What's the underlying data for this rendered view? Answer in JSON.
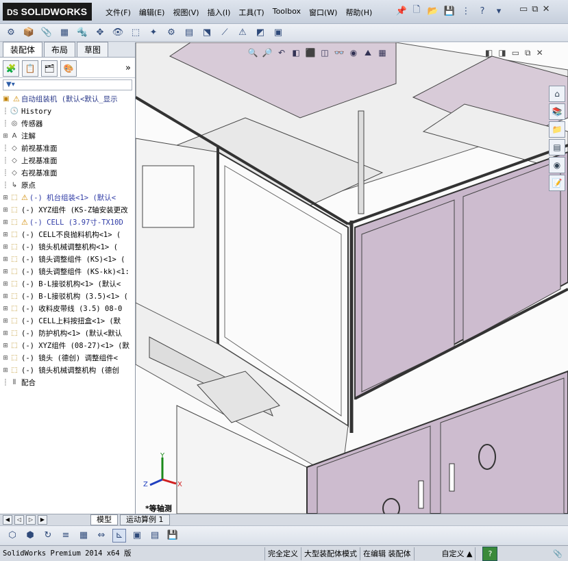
{
  "app": {
    "brand": "SOLIDWORKS",
    "brand_prefix": "DS"
  },
  "menu": [
    "文件(F)",
    "编辑(E)",
    "视图(V)",
    "插入(I)",
    "工具(T)",
    "Toolbox",
    "窗口(W)",
    "帮助(H)"
  ],
  "quick_tools": [
    "new-document-icon",
    "open-icon",
    "save-icon",
    "print-icon",
    "help-icon",
    "options-icon"
  ],
  "window_controls": [
    "minimize-icon",
    "restore-icon",
    "close-icon"
  ],
  "feature_manager": {
    "tabs": [
      "装配体",
      "布局",
      "草图"
    ],
    "active_tab": "装配体",
    "filter_icon": "filter-icon"
  },
  "tree": {
    "root": "自动组装机  (默认<默认_显示",
    "items": [
      {
        "label": "History",
        "icon": "history-icon",
        "expand": false
      },
      {
        "label": "传感器",
        "icon": "sensor-icon",
        "expand": false
      },
      {
        "label": "注解",
        "icon": "annotation-icon",
        "expand": true
      },
      {
        "label": "前视基准面",
        "icon": "plane-icon",
        "expand": false
      },
      {
        "label": "上视基准面",
        "icon": "plane-icon",
        "expand": false
      },
      {
        "label": "右视基准面",
        "icon": "plane-icon",
        "expand": false
      },
      {
        "label": "原点",
        "icon": "origin-icon",
        "expand": false
      },
      {
        "label": "(-) 机台组装<1> (默认<",
        "icon": "part-icon",
        "expand": true,
        "warning": true
      },
      {
        "label": "(-) XYZ组件 (KS-Z轴安装更改",
        "icon": "part-icon",
        "expand": true
      },
      {
        "label": "(-) CELL (3.97寸-TX10D",
        "icon": "part-icon",
        "expand": true,
        "warning": true
      },
      {
        "label": "(-) CELL不良抛料机构<1> (",
        "icon": "part-icon",
        "expand": true
      },
      {
        "label": "(-) 镜头机械调整机构<1> (",
        "icon": "part-icon",
        "expand": true
      },
      {
        "label": "(-) 镜头调整组件 (KS)<1> (",
        "icon": "part-icon",
        "expand": true
      },
      {
        "label": "(-) 镜头调整组件 (KS-kk)<1:",
        "icon": "part-icon",
        "expand": true
      },
      {
        "label": "(-) B-L接驳机构<1> (默认<",
        "icon": "part-icon",
        "expand": true
      },
      {
        "label": "(-) B-L接驳机构 (3.5)<1> (",
        "icon": "part-icon",
        "expand": true
      },
      {
        "label": "(-) 收料皮带线 (3.5) 08-0",
        "icon": "part-icon",
        "expand": true
      },
      {
        "label": "(-) CELL上料按扭盒<1> (默",
        "icon": "part-icon",
        "expand": true
      },
      {
        "label": "(-) 防护机构<1> (默认<默认",
        "icon": "part-icon",
        "expand": true
      },
      {
        "label": "(-) XYZ组件 (08-27)<1> (默",
        "icon": "part-icon",
        "expand": true
      },
      {
        "label": "(-) 镜头 (德创) 调整组件<",
        "icon": "part-icon",
        "expand": true
      },
      {
        "label": "(-) 镜头机械调整机构 (德创",
        "icon": "part-icon",
        "expand": true
      },
      {
        "label": "配合",
        "icon": "mates-icon",
        "expand": false
      }
    ]
  },
  "graphics": {
    "view_label": "*等轴测",
    "axes": [
      "Y",
      "Z",
      "X"
    ],
    "heads_up_tools": [
      "zoom-to-fit-icon",
      "zoom-to-area-icon",
      "previous-view-icon",
      "section-view-icon",
      "view-orientation-icon",
      "display-style-icon",
      "hide-show-icon",
      "edit-appearance-icon",
      "apply-scene-icon",
      "view-settings-icon"
    ]
  },
  "task_pane": [
    "home-icon",
    "design-library-icon",
    "file-explorer-icon",
    "view-palette-icon",
    "appearances-icon",
    "custom-properties-icon"
  ],
  "bottom_tabs": [
    "模型",
    "运动算例 1"
  ],
  "status": {
    "product": "SolidWorks Premium 2014 x64 版",
    "definition": "完全定义",
    "mode": "大型装配体模式",
    "editing": "在编辑 装配体",
    "custom": "自定义"
  }
}
